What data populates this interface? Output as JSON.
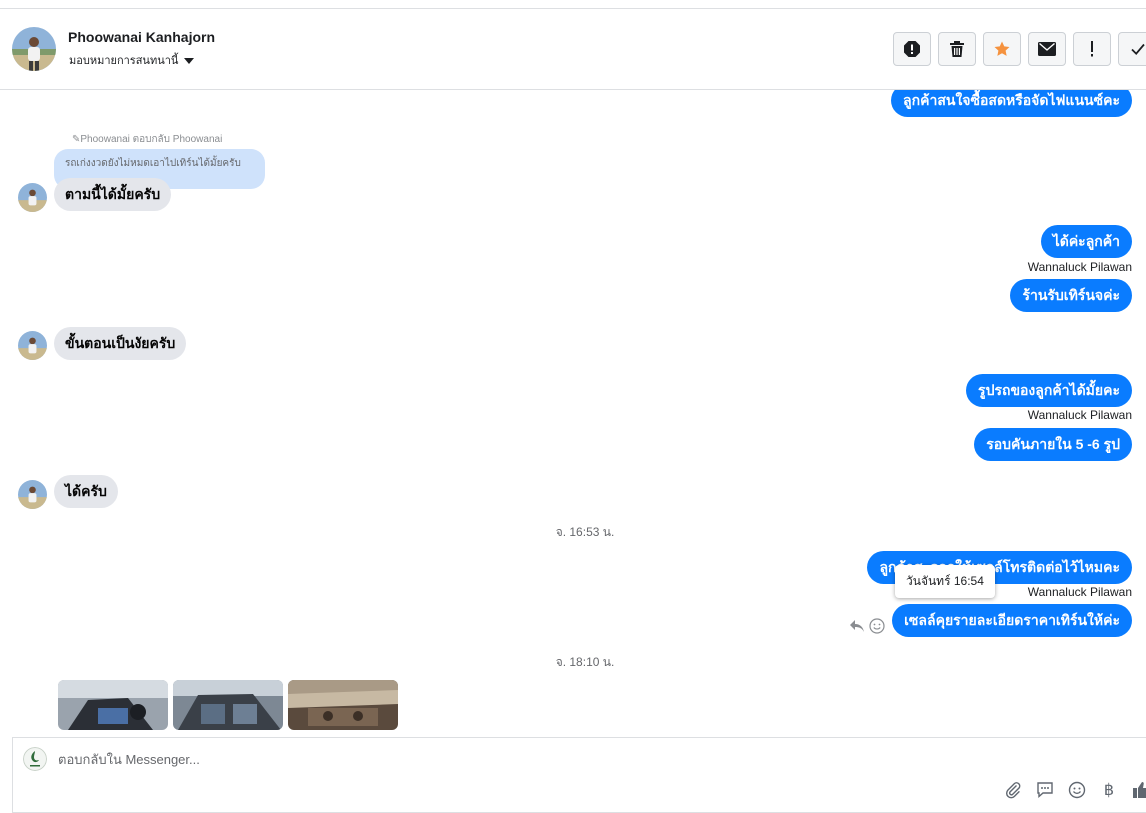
{
  "header": {
    "contact_name": "Phoowanai Kanhajorn",
    "assign_label": "มอบหมายการสนทนานี้",
    "actions": [
      "spam-icon",
      "trash-icon",
      "star-icon",
      "envelope-icon",
      "exclamation-icon",
      "check-icon"
    ]
  },
  "colors": {
    "accent": "#0a7cff",
    "incoming": "#e4e6eb",
    "quote": "#cfe2fb",
    "star": "#f5923e"
  },
  "thread": {
    "m0": "ลูกค้าสนใจซื้อสดหรือจัดไฟแนนซ์คะ",
    "reply_meta": "Phoowanai ตอบกลับ Phoowanai",
    "reply_quote": "รถเก่งงวดยังไม่หมดเอาไปเทิร์นได้มั้ยครับ",
    "m1": "ตามนี้ได้มั้ยครับ",
    "m2": "ได้ค่ะลูกค้า",
    "sender": "Wannaluck Pilawan",
    "m3": "ร้านรับเทิร์นจค่ะ",
    "m4": "ขั้นตอนเป็นงัยครับ",
    "m5": "รูปรถของลูกค้าได้มั้ยคะ",
    "m6": "รอบคันภายใน  5 -6 รูป",
    "m7": "ได้ครับ",
    "ts1": "จ. 16:53 น.",
    "m8": "ลูกค้าสะดวกให้เซลล์โทรติดต่อไว้ไหมคะ",
    "tooltip": "วันจันทร์ 16:54",
    "m9": "เซลล์คุยรายละเอียดราคาเทิร์นให้ค่ะ",
    "ts2": "จ. 18:10 น."
  },
  "composer": {
    "placeholder": "ตอบกลับใน Messenger...",
    "tools": [
      "paperclip-icon",
      "saved-reply-icon",
      "emoji-icon",
      "baht-icon",
      "like-icon"
    ]
  }
}
